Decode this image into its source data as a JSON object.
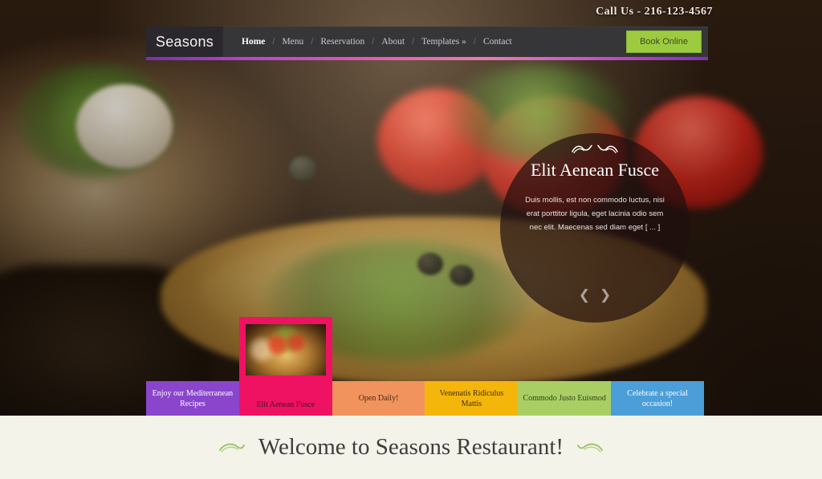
{
  "topbar": {
    "call_text": "Call Us - 216-123-4567"
  },
  "nav": {
    "logo": "Seasons",
    "separator": "/",
    "items": [
      {
        "label": "Home",
        "active": true
      },
      {
        "label": "Menu",
        "active": false
      },
      {
        "label": "Reservation",
        "active": false
      },
      {
        "label": "About",
        "active": false
      },
      {
        "label": "Templates »",
        "active": false
      },
      {
        "label": "Contact",
        "active": false
      }
    ],
    "book_label": "Book Online",
    "book_color": "#9ccb3f",
    "bar_color": "#363538",
    "logo_block_color": "#2a282c",
    "underline_colors": [
      "#7a2fb0",
      "#e85bb4",
      "#7e31b4"
    ]
  },
  "hero": {
    "caption": {
      "title": "Elit Aenean Fusce",
      "description": "Duis mollis, est non commodo luctus, nisi erat porttitor ligula, eget lacinia odio sem nec elit. Maecenas sed diam eget [ ... ]",
      "prev_icon": "chevron-left-icon",
      "next_icon": "chevron-right-icon",
      "ornament_icon": "flourish-ornament-icon",
      "circle_color": "#200e0e"
    },
    "thumbnails": [
      {
        "label": "Enjoy our Mediterranean Recipes",
        "color": "#8a45cc",
        "text_color": "#ffffff",
        "active": false
      },
      {
        "label": "Elit Aenean Fusce",
        "color": "#ef1263",
        "text_color": "#3d1020",
        "active": true
      },
      {
        "label": "Open Daily!",
        "color": "#f0935c",
        "text_color": "#4a2a14",
        "active": false
      },
      {
        "label": "Venenatis Ridiculus Mattis",
        "color": "#f5b60c",
        "text_color": "#3f2e06",
        "active": false
      },
      {
        "label": "Commodo Justo Euismod",
        "color": "#a9ce64",
        "text_color": "#33401b",
        "active": false
      },
      {
        "label": "Celebrate a special occasion!",
        "color": "#4b9ed8",
        "text_color": "#ffffff",
        "active": false
      }
    ]
  },
  "welcome": {
    "title": "Welcome to Seasons Restaurant!",
    "left_icon": "leaf-ornament-icon",
    "right_icon": "leaf-ornament-icon",
    "background": "#f4f3e9"
  }
}
